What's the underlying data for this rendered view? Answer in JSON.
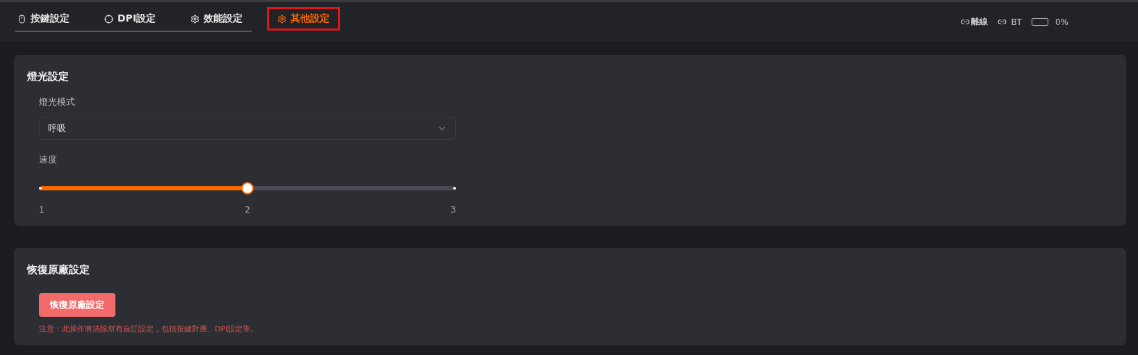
{
  "tabs": [
    {
      "label": "按鍵設定",
      "kind": "mouse",
      "selected": false
    },
    {
      "label": "DPI設定",
      "kind": "crosshair",
      "selected": false
    },
    {
      "label": "效能設定",
      "kind": "gear",
      "selected": false
    },
    {
      "label": "其他設定",
      "kind": "gear",
      "selected": true
    }
  ],
  "status": {
    "connection": "離線",
    "bt": "BT",
    "battery": "0%"
  },
  "lighting": {
    "title": "燈光設定",
    "mode_label": "燈光模式",
    "mode_value": "呼吸",
    "speed_label": "速度",
    "speed": {
      "level": 0.5,
      "ticks": [
        "1",
        "2",
        "3"
      ]
    }
  },
  "reset": {
    "title": "恢復原廠設定",
    "button": "恢復原廠設定",
    "warning": "注意：此操作將清除所有自訂設定，包括按鍵對應、DPI設定等。"
  }
}
